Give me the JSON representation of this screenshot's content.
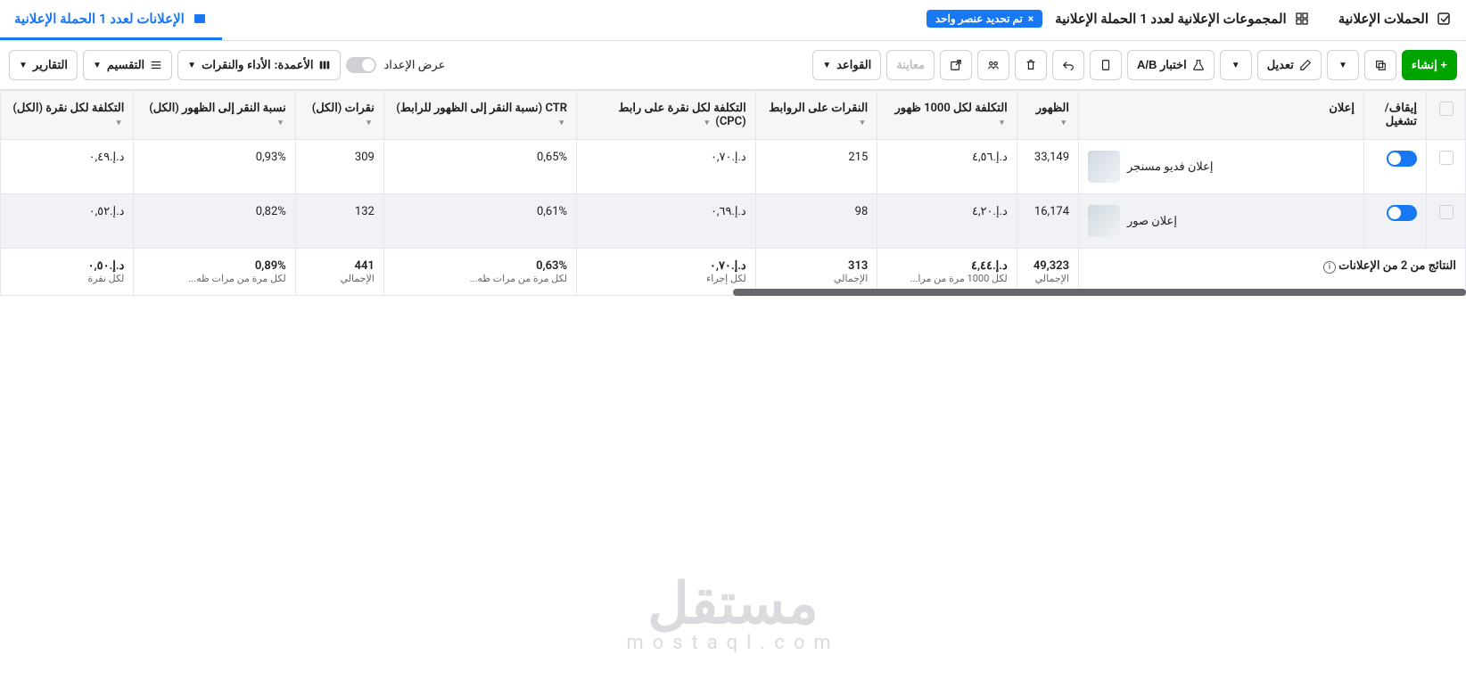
{
  "tabs": {
    "campaigns": {
      "label": "الحملات الإعلانية"
    },
    "adsets": {
      "label": "المجموعات الإعلانية لعدد 1 الحملة الإعلانية"
    },
    "ads": {
      "label": "الإعلانات لعدد 1 الحملة الإعلانية"
    },
    "chip": {
      "label": "تم تحديد عنصر واحد",
      "close": "×"
    }
  },
  "toolbar": {
    "create": "+ إنشاء",
    "edit": "تعديل",
    "ab_test": "اختبار A/B",
    "preview": "معاينة",
    "rules": "القواعد",
    "view_setup": "عرض الإعداد",
    "columns": "الأعمدة: الأداء والنقرات",
    "breakdown": "التقسيم",
    "reports": "التقارير"
  },
  "headers": {
    "toggle": "إيقاف/\nتشغيل",
    "ad": "إعلان",
    "impressions": "الظهور",
    "cpm": "التكلفة لكل 1000 ظهور",
    "link_clicks": "النقرات على الروابط",
    "cpc_link": "التكلفة لكل نقرة على رابط (CPC)",
    "ctr_link": "CTR (نسبة النقر إلى الظهور للرابط)",
    "clicks_all": "نقرات (الكل)",
    "ctr_all": "نسبة النقر إلى الظهور (الكل)",
    "cpc_all": "التكلفة لكل نقرة (الكل)"
  },
  "rows": [
    {
      "name": "إعلان فديو مسنجر",
      "impressions": "33,149",
      "cpm": "د.إ.٤,٥٦",
      "link_clicks": "215",
      "cpc_link": "د.إ.٠,٧٠",
      "ctr_link": "0,65%",
      "clicks_all": "309",
      "ctr_all": "0,93%",
      "cpc_all": "د.إ.٠,٤٩"
    },
    {
      "name": "إعلان صور",
      "impressions": "16,174",
      "cpm": "د.إ.٤,٢٠",
      "link_clicks": "98",
      "cpc_link": "د.إ.٠,٦٩",
      "ctr_link": "0,61%",
      "clicks_all": "132",
      "ctr_all": "0,82%",
      "cpc_all": "د.إ.٠,٥٢"
    }
  ],
  "summary": {
    "title": "النتائج من 2 من الإعلانات",
    "impressions": {
      "val": "49,323",
      "sub": "الإجمالي"
    },
    "cpm": {
      "val": "د.إ.٤,٤٤",
      "sub": "لكل 1000 مرة من مرا..."
    },
    "link_clicks": {
      "val": "313",
      "sub": "الإجمالي"
    },
    "cpc_link": {
      "val": "د.إ.٠,٧٠",
      "sub": "لكل إجراء"
    },
    "ctr_link": {
      "val": "0,63%",
      "sub": "لكل مرة من مرات ظه..."
    },
    "clicks_all": {
      "val": "441",
      "sub": "الإجمالي"
    },
    "ctr_all": {
      "val": "0,89%",
      "sub": "لكل مرة من مرات ظه..."
    },
    "cpc_all": {
      "val": "د.إ.٠,٥٠",
      "sub": "لكل نقرة"
    }
  },
  "watermark": {
    "ar": "مستقل",
    "en": "mostaql.com"
  }
}
